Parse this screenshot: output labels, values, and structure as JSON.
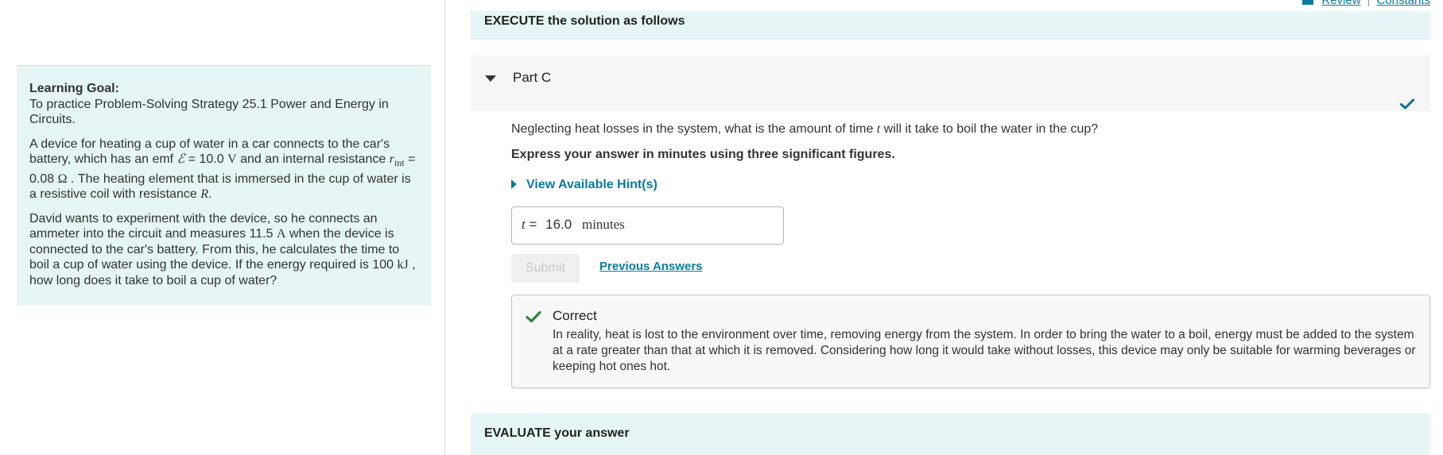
{
  "top_links": {
    "review": "Review",
    "separator": "|",
    "constants": "Constants"
  },
  "goal": {
    "title": "Learning Goal:",
    "intro": "To practice Problem-Solving Strategy 25.1 Power and Energy in Circuits.",
    "p1_a": "A device for heating a cup of water in a car connects to the car's battery, which has an emf ",
    "emf_symbol": "ℰ",
    "p1_b": " = 10.0 ",
    "unit_V": "V",
    "p1_c": " and an internal resistance ",
    "r_symbol": "r",
    "r_sub": "int",
    "p1_d": " = 0.08 ",
    "unit_ohm": "Ω",
    "p1_e": " . The heating element that is immersed in the cup of water is a resistive coil with resistance ",
    "R_symbol": "R",
    "p1_f": ".",
    "p2_a": "David wants to experiment with the device, so he connects an ammeter into the circuit and measures 11.5 ",
    "unit_A": "A",
    "p2_b": " when the device is connected to the car's battery. From this, he calculates the time to boil a cup of water using the device. If the energy required is 100 ",
    "unit_kJ": "kJ",
    "p2_c": " , how long does it take to boil a cup of water?"
  },
  "execute_label": "EXECUTE the solution as follows",
  "part": {
    "title": "Part C"
  },
  "question": {
    "a": "Neglecting heat losses in the system, what is the amount of time ",
    "t_symbol": "t",
    "b": " will it take to boil the water in the cup?"
  },
  "instruction": "Express your answer in minutes using three significant figures.",
  "hint_label": "View Available Hint(s)",
  "answer": {
    "var": "t",
    "eq": "=",
    "value": "16.0",
    "unit": "minutes"
  },
  "submit_label": "Submit",
  "previous_answers_label": "Previous Answers",
  "feedback": {
    "title": "Correct",
    "text": "In reality, heat is lost to the environment over time, removing energy from the system. In order to bring the water to a boil, energy must be added to the system at a rate greater than that at which it is removed. Considering how long it would take without losses, this device may only be suitable for warming beverages or keeping hot ones hot."
  },
  "evaluate_label": "EVALUATE your answer",
  "colors": {
    "accent": "#0a7ba0",
    "panel_bg": "#e6f5f5",
    "correct_green": "#2e8540",
    "check_blue": "#0a6ea0"
  }
}
